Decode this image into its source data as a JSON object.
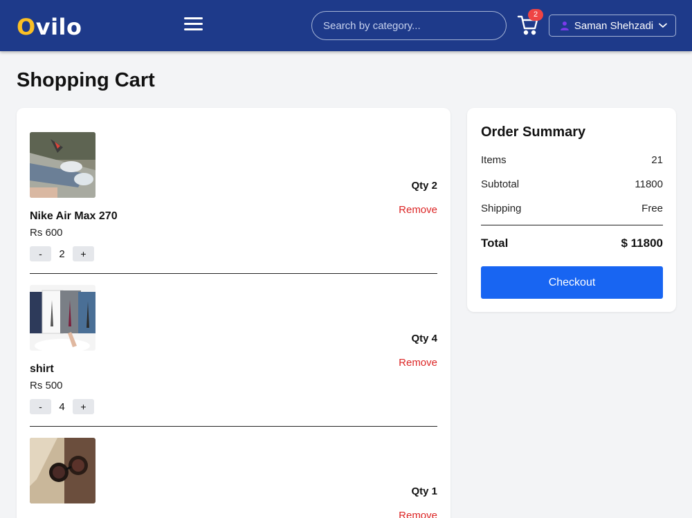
{
  "header": {
    "logo_first": "O",
    "logo_rest": "vilo",
    "search_placeholder": "Search by category...",
    "cart_count": "2",
    "user_name": "Saman Shehzadi",
    "accent_color": "#fbbf24",
    "bar_color": "#1e3a8a"
  },
  "page": {
    "title": "Shopping Cart"
  },
  "cart": {
    "items": [
      {
        "name": "Nike Air Max 270",
        "price": "Rs 600",
        "quantity": "2",
        "qty_label": "Qty 2",
        "remove_label": "Remove",
        "decrement_label": "-",
        "increment_label": "+"
      },
      {
        "name": "shirt",
        "price": "Rs 500",
        "quantity": "4",
        "qty_label": "Qty 4",
        "remove_label": "Remove",
        "decrement_label": "-",
        "increment_label": "+"
      },
      {
        "name": "",
        "price": "",
        "quantity": "1",
        "qty_label": "Qty 1",
        "remove_label": "Remove",
        "decrement_label": "-",
        "increment_label": "+"
      }
    ]
  },
  "summary": {
    "title": "Order Summary",
    "items_label": "Items",
    "items_value": "21",
    "subtotal_label": "Subtotal",
    "subtotal_value": "11800",
    "shipping_label": "Shipping",
    "shipping_value": "Free",
    "total_label": "Total",
    "total_value": "$ 11800",
    "checkout_label": "Checkout",
    "checkout_color": "#1865f2"
  }
}
